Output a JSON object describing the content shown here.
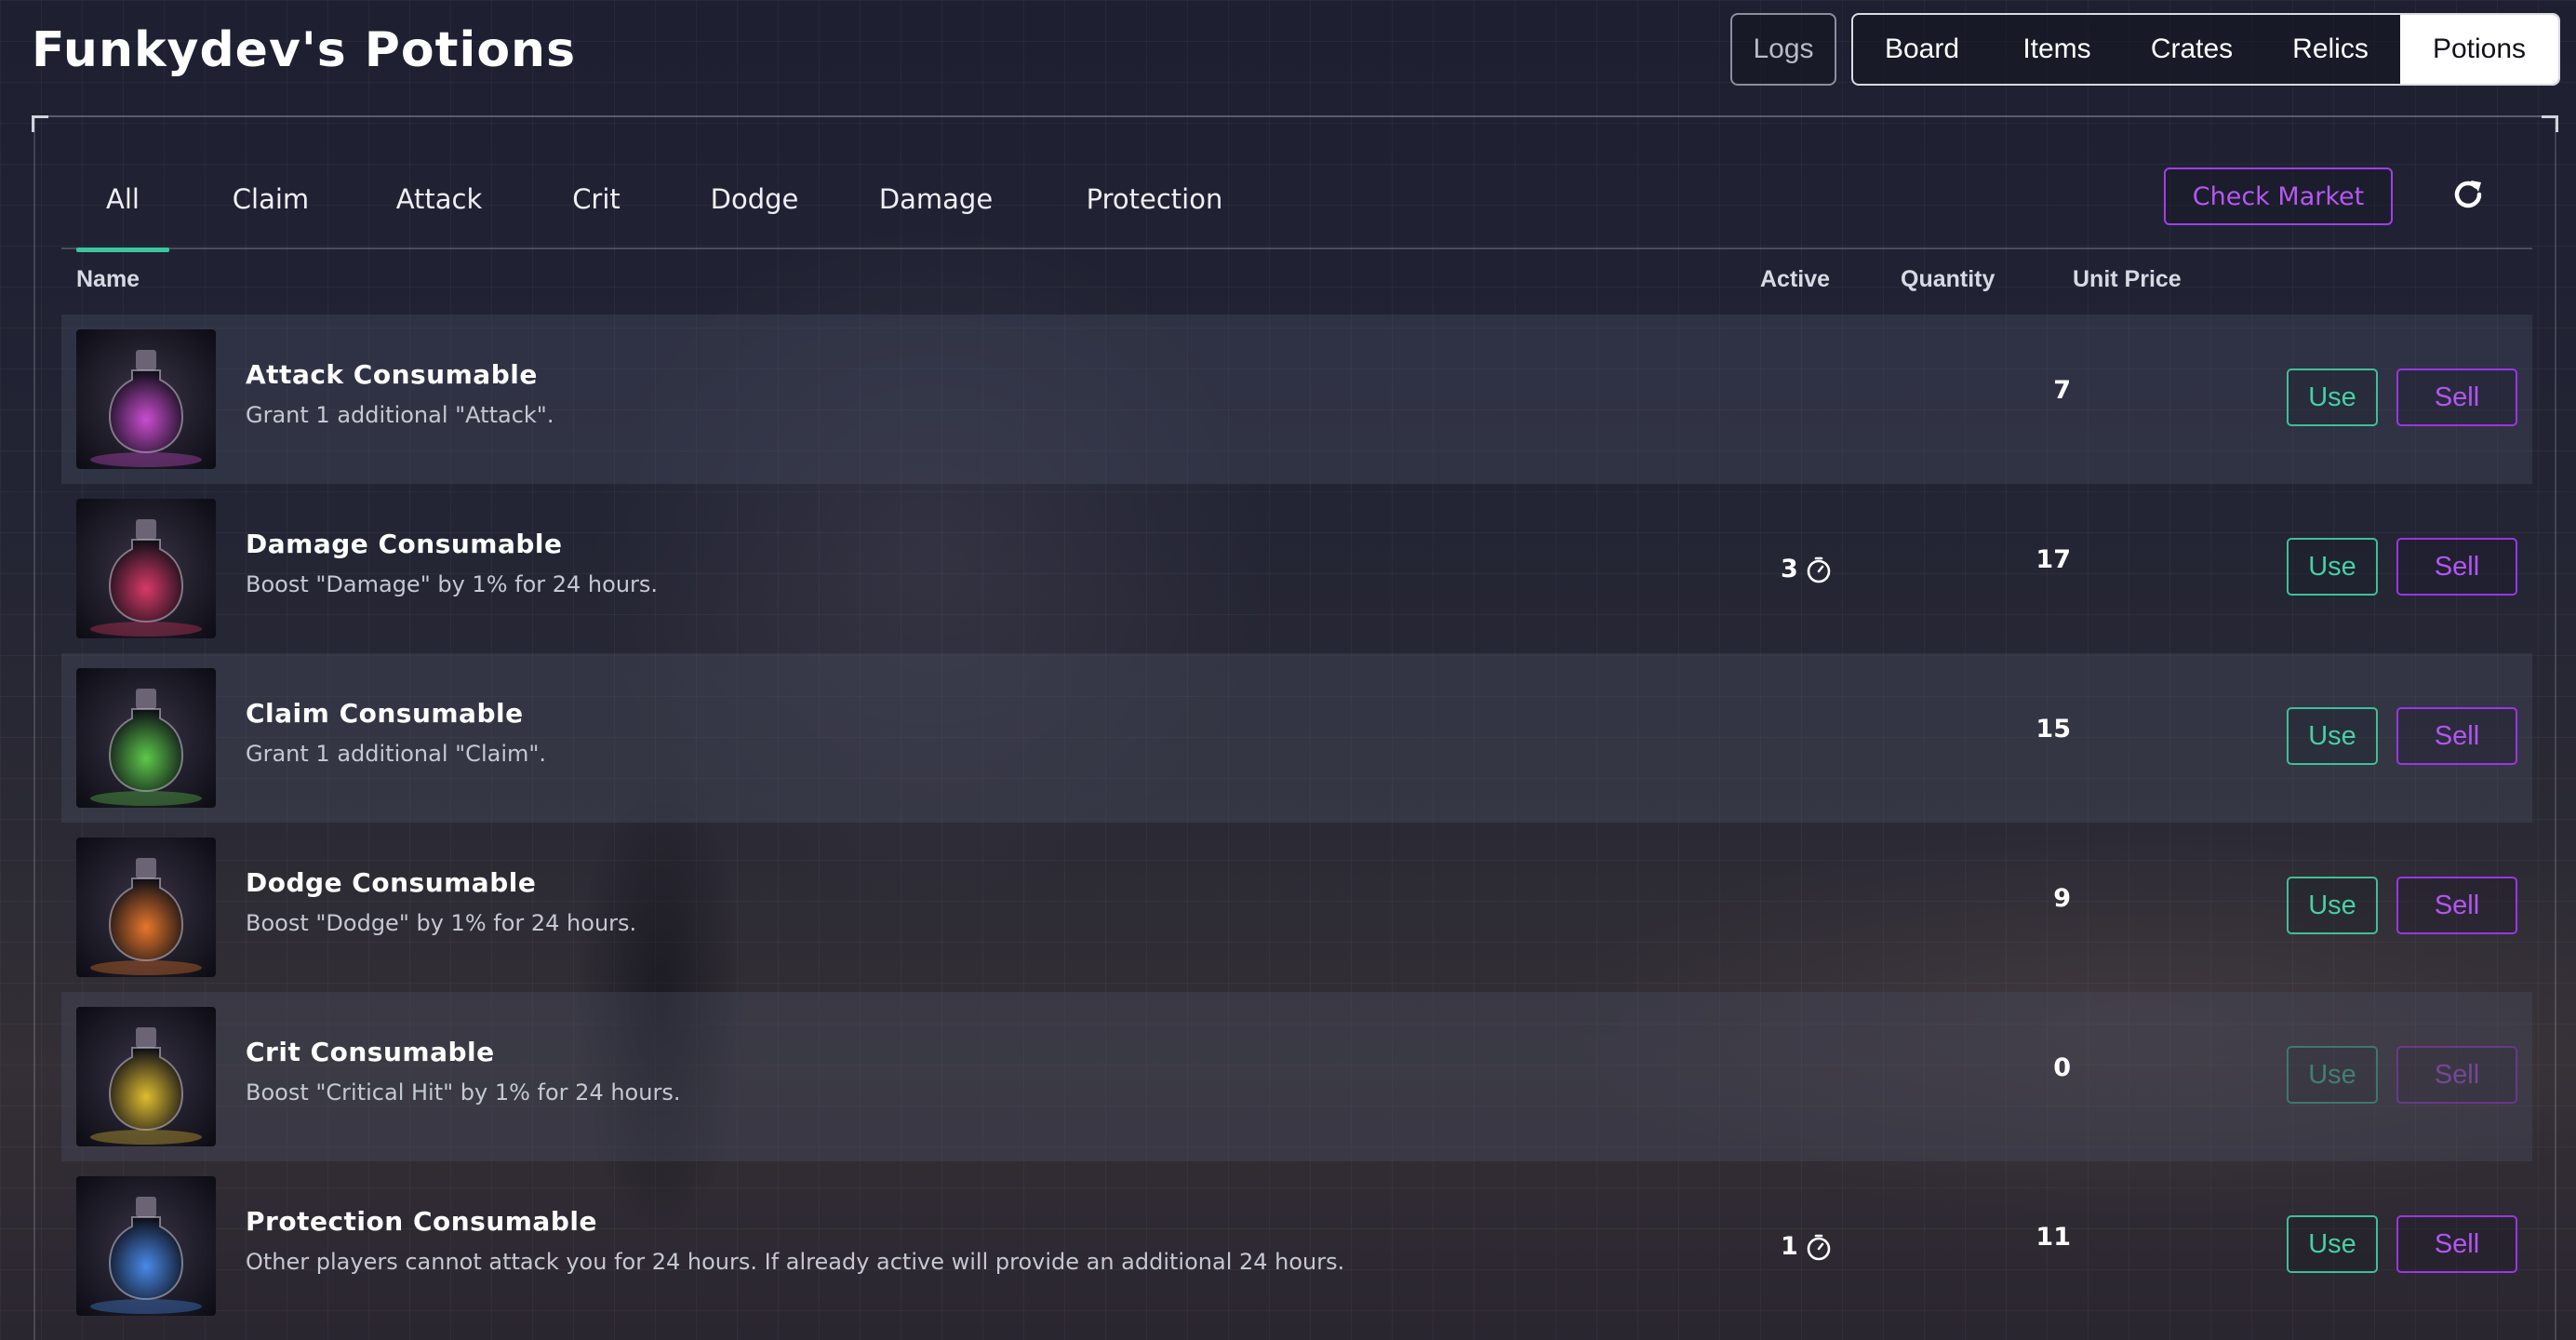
{
  "header": {
    "title": "Funkydev's Potions",
    "logs_label": "Logs",
    "nav": [
      {
        "label": "Board"
      },
      {
        "label": "Items"
      },
      {
        "label": "Crates"
      },
      {
        "label": "Relics"
      },
      {
        "label": "Potions",
        "active": true
      }
    ]
  },
  "filters": {
    "tabs": [
      "All",
      "Claim",
      "Attack",
      "Crit",
      "Dodge",
      "Damage",
      "Protection"
    ],
    "active_tab": "All",
    "check_market_label": "Check Market"
  },
  "table": {
    "columns": {
      "name": "Name",
      "active": "Active",
      "quantity": "Quantity",
      "unit_price": "Unit Price"
    },
    "rows": [
      {
        "name": "Attack Consumable",
        "description": "Grant 1 additional \"Attack\".",
        "active": "",
        "quantity": "7",
        "use": "Use",
        "sell": "Sell",
        "potion_color": "#d14fd6"
      },
      {
        "name": "Damage Consumable",
        "description": "Boost \"Damage\" by 1% for 24 hours.",
        "active": "3",
        "quantity": "17",
        "use": "Use",
        "sell": "Sell",
        "potion_color": "#e03a6a"
      },
      {
        "name": "Claim Consumable",
        "description": "Grant 1 additional \"Claim\".",
        "active": "",
        "quantity": "15",
        "use": "Use",
        "sell": "Sell",
        "potion_color": "#5fd14a"
      },
      {
        "name": "Dodge Consumable",
        "description": "Boost \"Dodge\" by 1% for 24 hours.",
        "active": "",
        "quantity": "9",
        "use": "Use",
        "sell": "Sell",
        "potion_color": "#f07a2a"
      },
      {
        "name": "Crit Consumable",
        "description": "Boost \"Critical Hit\" by 1% for 24 hours.",
        "active": "",
        "quantity": "0",
        "use": "Use",
        "sell": "Sell",
        "potion_color": "#e8c430",
        "disabled": true
      },
      {
        "name": "Protection Consumable",
        "description": "Other players cannot attack you for 24 hours. If already active will provide an additional 24 hours.",
        "active": "1",
        "quantity": "11",
        "use": "Use",
        "sell": "Sell",
        "potion_color": "#4a8ef0"
      }
    ]
  },
  "colors": {
    "accent_green": "#3fbf97",
    "accent_purple": "#9a36e3",
    "background": "#1b1d2b"
  },
  "icons": {
    "refresh": "refresh-icon",
    "timer": "timer-icon"
  }
}
